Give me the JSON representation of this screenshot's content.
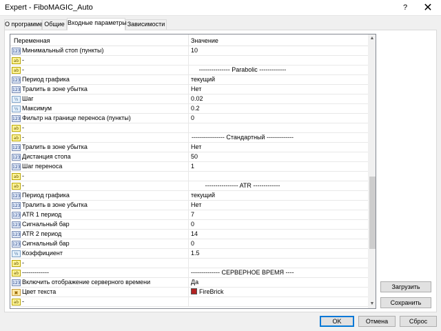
{
  "window": {
    "title": "Expert - FiboMAGIC_Auto",
    "help_label": "?",
    "close_label": "✕"
  },
  "tabs": [
    {
      "label": "О программе"
    },
    {
      "label": "Общие"
    },
    {
      "label": "Входные параметры"
    },
    {
      "label": "Зависимости"
    }
  ],
  "grid": {
    "col_variable": "Переменная",
    "col_value": "Значение",
    "rows": [
      {
        "icon": "123",
        "name": "Минимальный стоп   (пункты)",
        "value": "10"
      },
      {
        "icon": "ab",
        "name": "-",
        "value": ""
      },
      {
        "icon": "ab",
        "name": "-",
        "value": "--------------- Parabolic -------------",
        "sep": true
      },
      {
        "icon": "123",
        "name": "Период графика",
        "value": "текущий"
      },
      {
        "icon": "123",
        "name": "Тралить в зоне убытка",
        "value": "Нет"
      },
      {
        "icon": "v2",
        "name": "Шаг",
        "value": "0.02"
      },
      {
        "icon": "v2",
        "name": "Максимум",
        "value": "0.2"
      },
      {
        "icon": "123",
        "name": "Фильтр на границе переноса   (пункты)",
        "value": "0"
      },
      {
        "icon": "ab",
        "name": "-",
        "value": ""
      },
      {
        "icon": "ab",
        "name": "-",
        "value": "---------------- Стандартный -------------",
        "sep": true
      },
      {
        "icon": "123",
        "name": "Тралить в зоне убытка",
        "value": "Нет"
      },
      {
        "icon": "123",
        "name": "Дистанция стопа",
        "value": "50"
      },
      {
        "icon": "123",
        "name": "Шаг переноса",
        "value": "1"
      },
      {
        "icon": "ab",
        "name": "-",
        "value": ""
      },
      {
        "icon": "ab",
        "name": "-",
        "value": "---------------- ATR -------------",
        "sep": true
      },
      {
        "icon": "123",
        "name": "Период графика",
        "value": "текущий"
      },
      {
        "icon": "123",
        "name": "Тралить в зоне убытка",
        "value": "Нет"
      },
      {
        "icon": "123",
        "name": "ATR 1 период",
        "value": "7"
      },
      {
        "icon": "123",
        "name": "Сигнальный бар",
        "value": "0"
      },
      {
        "icon": "123",
        "name": "ATR 2 период",
        "value": "14"
      },
      {
        "icon": "123",
        "name": "Сигнальный бар",
        "value": "0"
      },
      {
        "icon": "v2",
        "name": "Коэффициент",
        "value": "1.5"
      },
      {
        "icon": "ab",
        "name": "-",
        "value": ""
      },
      {
        "icon": "ab",
        "name": "-------------",
        "value": "-------------- СЕРВЕРНОЕ ВРЕМЯ -------------",
        "sep": true
      },
      {
        "icon": "123",
        "name": "Включить отображение серверного времени",
        "value": "Да"
      },
      {
        "icon": "clr",
        "name": "Цвет текста",
        "value": "FireBrick",
        "swatch": "#b22222"
      },
      {
        "icon": "ab",
        "name": "-",
        "value": ""
      }
    ]
  },
  "scroll": {
    "position": 0.62
  },
  "side_buttons": {
    "load": "Загрузить",
    "save": "Сохранить"
  },
  "footer_buttons": {
    "ok": "OK",
    "cancel": "Отмена",
    "reset": "Сброс"
  },
  "icon_labels": {
    "123": "123",
    "ab": "ab",
    "v2": "½",
    "clr": "▣"
  }
}
